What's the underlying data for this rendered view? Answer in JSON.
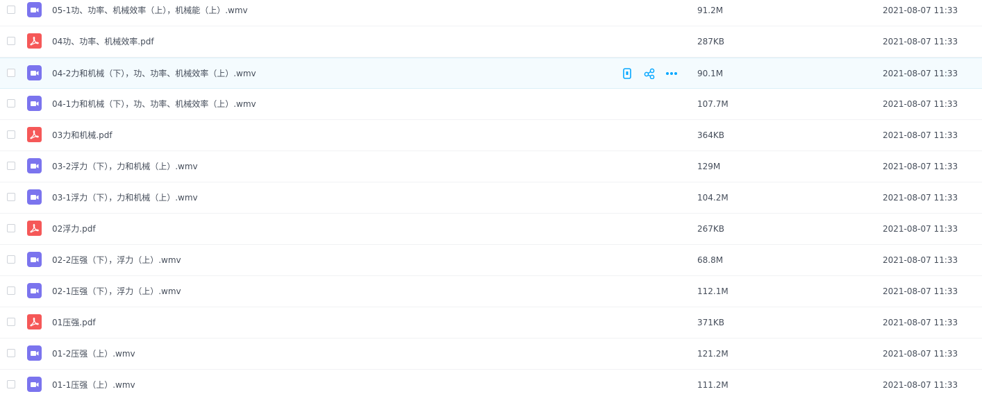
{
  "colors": {
    "video_icon": "#7b74ee",
    "pdf_icon": "#f55858",
    "action_icon": "#06a7ff",
    "text": "#454d5a",
    "row_border": "#f1f2f4",
    "hover_bg": "#f4fbfe"
  },
  "hovered_row_actions": [
    {
      "name": "phone-icon",
      "label": ""
    },
    {
      "name": "share-icon",
      "label": ""
    },
    {
      "name": "more-icon",
      "label": ""
    }
  ],
  "files": [
    {
      "name": "05-1功、功率、机械效率（上），机械能（上）.wmv",
      "type": "video",
      "size": "91.2M",
      "date": "2021-08-07 11:33"
    },
    {
      "name": "04功、功率、机械效率.pdf",
      "type": "pdf",
      "size": "287KB",
      "date": "2021-08-07 11:33"
    },
    {
      "name": "04-2力和机械（下），功、功率、机械效率（上）.wmv",
      "type": "video",
      "size": "90.1M",
      "date": "2021-08-07 11:33",
      "hovered": true
    },
    {
      "name": "04-1力和机械（下），功、功率、机械效率（上）.wmv",
      "type": "video",
      "size": "107.7M",
      "date": "2021-08-07 11:33"
    },
    {
      "name": "03力和机械.pdf",
      "type": "pdf",
      "size": "364KB",
      "date": "2021-08-07 11:33"
    },
    {
      "name": "03-2浮力（下），力和机械（上）.wmv",
      "type": "video",
      "size": "129M",
      "date": "2021-08-07 11:33"
    },
    {
      "name": "03-1浮力（下），力和机械（上）.wmv",
      "type": "video",
      "size": "104.2M",
      "date": "2021-08-07 11:33"
    },
    {
      "name": "02浮力.pdf",
      "type": "pdf",
      "size": "267KB",
      "date": "2021-08-07 11:33"
    },
    {
      "name": "02-2压强（下），浮力（上）.wmv",
      "type": "video",
      "size": "68.8M",
      "date": "2021-08-07 11:33"
    },
    {
      "name": "02-1压强（下），浮力（上）.wmv",
      "type": "video",
      "size": "112.1M",
      "date": "2021-08-07 11:33"
    },
    {
      "name": "01压强.pdf",
      "type": "pdf",
      "size": "371KB",
      "date": "2021-08-07 11:33"
    },
    {
      "name": "01-2压强（上）.wmv",
      "type": "video",
      "size": "121.2M",
      "date": "2021-08-07 11:33"
    },
    {
      "name": "01-1压强（上）.wmv",
      "type": "video",
      "size": "111.2M",
      "date": "2021-08-07 11:33"
    }
  ]
}
